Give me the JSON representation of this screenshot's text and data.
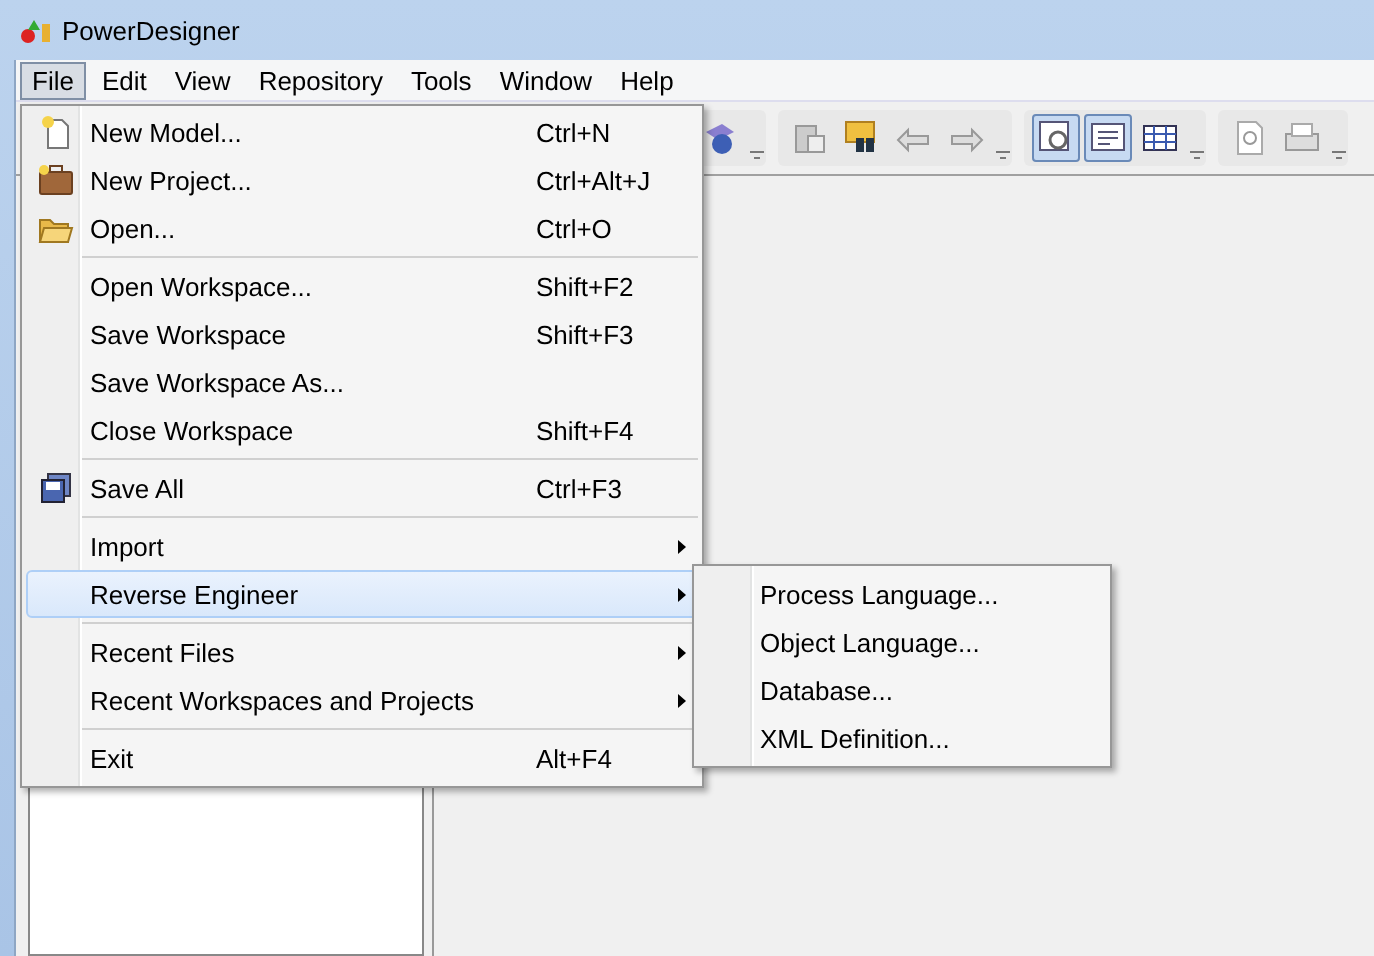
{
  "window": {
    "title": "PowerDesigner"
  },
  "menubar": [
    {
      "label": "File",
      "selected": true
    },
    {
      "label": "Edit",
      "selected": false
    },
    {
      "label": "View",
      "selected": false
    },
    {
      "label": "Repository",
      "selected": false
    },
    {
      "label": "Tools",
      "selected": false
    },
    {
      "label": "Window",
      "selected": false
    },
    {
      "label": "Help",
      "selected": false
    }
  ],
  "toolbar": [
    [
      {
        "kind": "help",
        "selected": false
      }
    ],
    [
      {
        "kind": "paste",
        "selected": false
      },
      {
        "kind": "find",
        "selected": false
      },
      {
        "kind": "back",
        "selected": false
      },
      {
        "kind": "forward",
        "selected": false
      }
    ],
    [
      {
        "kind": "browser",
        "selected": true
      },
      {
        "kind": "output",
        "selected": true
      },
      {
        "kind": "table",
        "selected": false
      }
    ],
    [
      {
        "kind": "preview",
        "selected": false
      },
      {
        "kind": "print",
        "selected": false
      }
    ]
  ],
  "file_menu": [
    [
      {
        "label": "New Model...",
        "shortcut": "Ctrl+N",
        "kind": "new-model",
        "submenu": false,
        "selected": false
      },
      {
        "label": "New Project...",
        "shortcut": "Ctrl+Alt+J",
        "kind": "new-project",
        "submenu": false,
        "selected": false
      },
      {
        "label": "Open...",
        "shortcut": "Ctrl+O",
        "kind": "open",
        "submenu": false,
        "selected": false
      }
    ],
    [
      {
        "label": "Open Workspace...",
        "shortcut": "Shift+F2",
        "submenu": false,
        "selected": false
      },
      {
        "label": "Save Workspace",
        "shortcut": "Shift+F3",
        "submenu": false,
        "selected": false
      },
      {
        "label": "Save Workspace As...",
        "submenu": false,
        "selected": false
      },
      {
        "label": "Close Workspace",
        "shortcut": "Shift+F4",
        "submenu": false,
        "selected": false
      }
    ],
    [
      {
        "label": "Save All",
        "shortcut": "Ctrl+F3",
        "kind": "save-all",
        "submenu": false,
        "selected": false
      }
    ],
    [
      {
        "label": "Import",
        "submenu": true,
        "selected": false
      },
      {
        "label": "Reverse Engineer",
        "submenu": true,
        "selected": true
      }
    ],
    [
      {
        "label": "Recent Files",
        "submenu": true,
        "selected": false
      },
      {
        "label": "Recent Workspaces and Projects",
        "submenu": true,
        "selected": false
      }
    ],
    [
      {
        "label": "Exit",
        "shortcut": "Alt+F4",
        "submenu": false,
        "selected": false
      }
    ]
  ],
  "reverse_engineer_submenu": [
    {
      "label": "Process Language..."
    },
    {
      "label": "Object Language..."
    },
    {
      "label": "Database..."
    },
    {
      "label": "XML Definition..."
    }
  ]
}
